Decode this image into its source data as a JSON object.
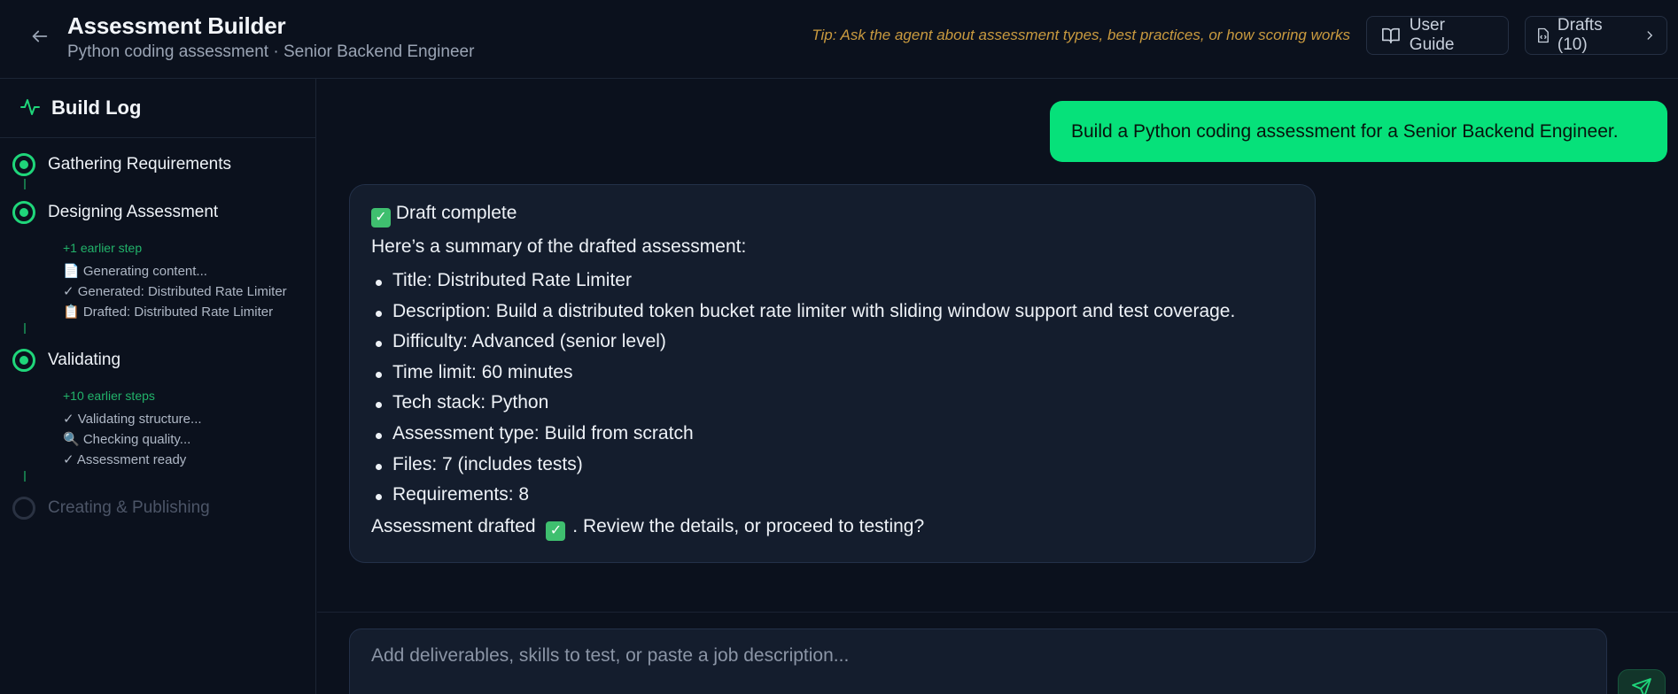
{
  "header": {
    "title": "Assessment Builder",
    "subtitle": "Python coding assessment · Senior Backend Engineer",
    "tip": "Tip: Ask the agent about assessment types, best practices, or how scoring works",
    "user_guide_label": "User Guide",
    "drafts_label": "Drafts (10)"
  },
  "sidebar": {
    "title": "Build Log",
    "steps": [
      {
        "label": "Gathering Requirements",
        "status": "active"
      },
      {
        "label": "Designing Assessment",
        "status": "active",
        "earlier": "+1 earlier step",
        "items": [
          "📄 Generating content...",
          "✓ Generated: Distributed Rate Limiter",
          "📋 Drafted: Distributed Rate Limiter"
        ]
      },
      {
        "label": "Validating",
        "status": "active",
        "earlier": "+10 earlier steps",
        "items": [
          "✓ Validating structure...",
          "🔍 Checking quality...",
          "✓ Assessment ready"
        ]
      },
      {
        "label": "Creating & Publishing",
        "status": "pending"
      }
    ]
  },
  "chat": {
    "user_message": "Build a Python coding assessment for a Senior Backend Engineer.",
    "agent": {
      "heading": "Draft complete",
      "intro": "Here’s a summary of the drafted assessment:",
      "bullets": [
        "Title: Distributed Rate Limiter",
        "Description: Build a distributed token bucket rate limiter with sliding window support and test coverage.",
        "Difficulty: Advanced (senior level)",
        "Time limit: 60 minutes",
        "Tech stack: Python",
        "Assessment type: Build from scratch",
        "Files: 7 (includes tests)",
        "Requirements: 8"
      ],
      "footer_before": "Assessment drafted",
      "footer_after": ". Review the details, or proceed to testing?"
    }
  },
  "composer": {
    "placeholder": "Add deliverables, skills to test, or paste a job description..."
  },
  "colors": {
    "accent": "#06e17a",
    "background": "#0b111d",
    "card": "#141d2d",
    "tip": "#c99a3f"
  },
  "icons": [
    "arrow-left-icon",
    "book-open-icon",
    "file-code-icon",
    "chevron-right-icon",
    "activity-icon",
    "check-square-icon",
    "send-icon"
  ]
}
